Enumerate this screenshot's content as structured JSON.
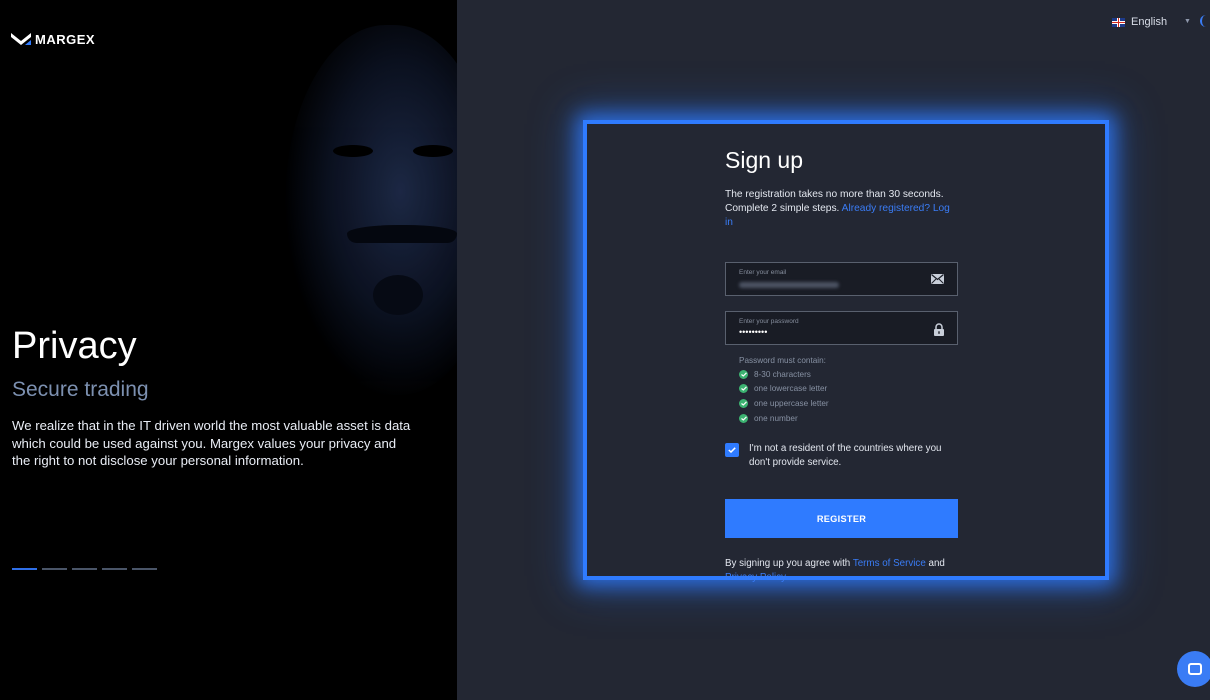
{
  "brand": {
    "name": "MARGEX"
  },
  "hero": {
    "title": "Privacy",
    "subtitle": "Secure trading",
    "body": "We realize that in the IT driven world the most valuable asset is data which could be used against you. Margex values your privacy and the right to not disclose your personal information.",
    "slides_total": 5,
    "slide_active": 1
  },
  "header": {
    "language": "English"
  },
  "signup": {
    "title": "Sign up",
    "intro_line1": "The registration takes no more than 30 seconds.",
    "intro_line2": "Complete 2 simple steps.",
    "login_link": "Already registered? Log in",
    "email": {
      "label": "Enter your email"
    },
    "password": {
      "label": "Enter your password",
      "value": "•••••••••"
    },
    "password_rules": {
      "heading": "Password must contain:",
      "items": [
        "8-30 characters",
        "one lowercase letter",
        "one uppercase letter",
        "one number"
      ]
    },
    "consent": "I'm not a resident of the countries where you don't provide service.",
    "consent_checked": true,
    "register_label": "REGISTER",
    "terms_prefix": "By signing up you agree with",
    "terms_link": "Terms of Service",
    "terms_and": "and",
    "privacy_link": "Privacy Policy"
  },
  "colors": {
    "accent": "#2f7bff",
    "success": "#3cb371",
    "panel": "#232733"
  },
  "icons": {
    "email": "envelope-icon",
    "password": "lock-icon",
    "chat": "chat-icon",
    "theme": "moon-icon"
  }
}
